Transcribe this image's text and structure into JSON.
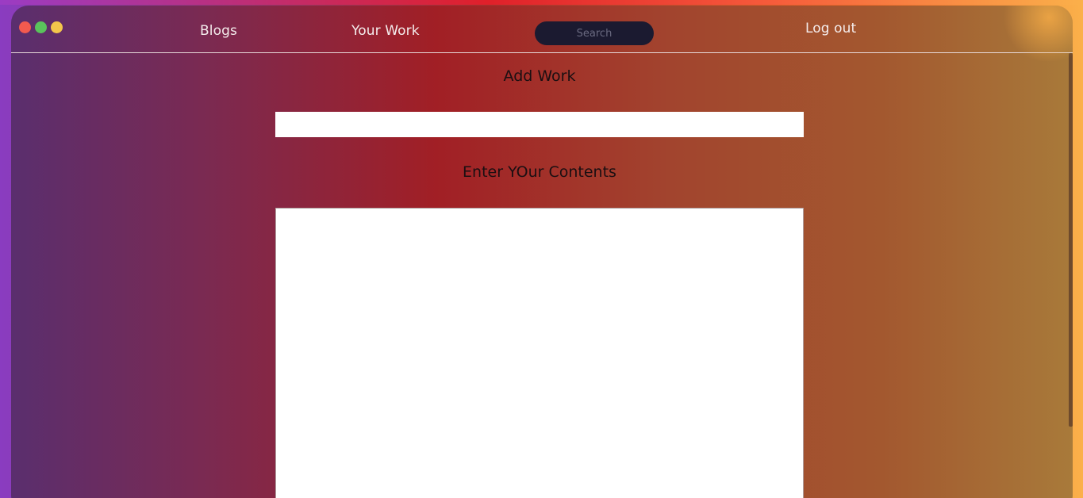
{
  "nav": {
    "blogs": "Blogs",
    "your_work": "Your Work",
    "logout": "Log out"
  },
  "search": {
    "placeholder": "Search",
    "value": ""
  },
  "form": {
    "title_heading": "Add Work",
    "title_value": "",
    "content_heading": "Enter YOur Contents",
    "content_value": ""
  },
  "colors": {
    "window_dots": [
      "#f25a4f",
      "#5ac35c",
      "#f3c64b"
    ],
    "search_bg": "#1b1a30"
  }
}
